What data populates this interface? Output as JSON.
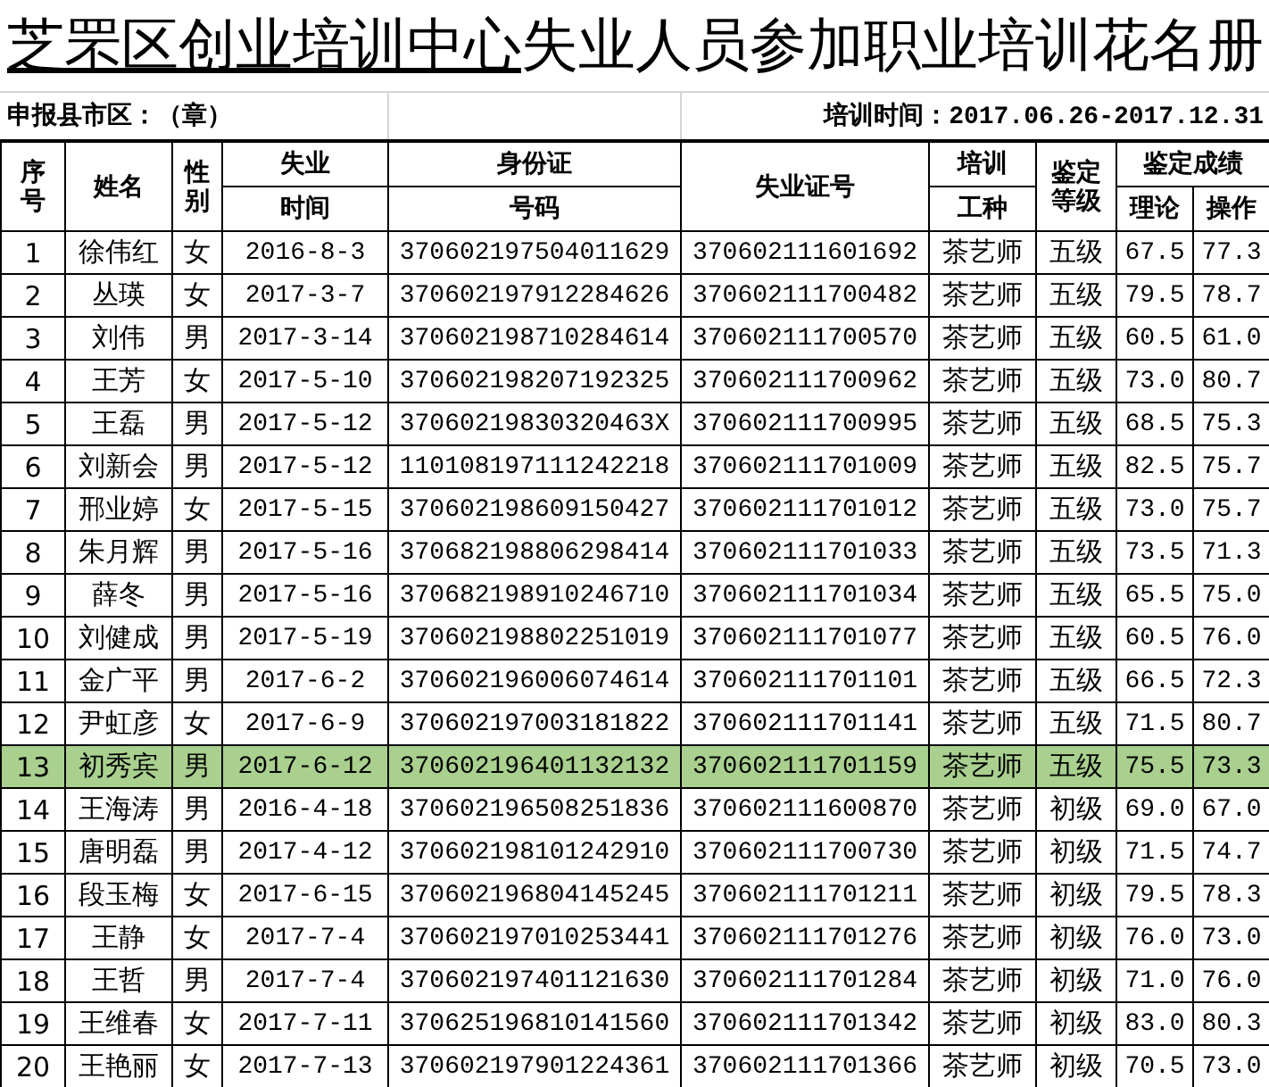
{
  "title": {
    "underlined": "芝罘区创业培训中心",
    "rest": "失业人员参加职业培训花名册"
  },
  "info": {
    "district": "申报县市区：（章）",
    "period": "培训时间：2017.06.26-2017.12.31"
  },
  "headers": {
    "seq": "序号",
    "name": "姓名",
    "gender": "性别",
    "time": [
      "失业",
      "时间"
    ],
    "id": [
      "身份证",
      "号码"
    ],
    "cert": "失业证号",
    "kind": [
      "培训",
      "工种"
    ],
    "level": "鉴定等级",
    "score": "鉴定成绩",
    "theory": "理论",
    "practice": "操作"
  },
  "rows": [
    {
      "no": "1",
      "name": "徐伟红",
      "gender": "女",
      "date": "2016-8-3",
      "id": "370602197504011629",
      "cert": "370602111601692",
      "job": "茶艺师",
      "grade": "五级",
      "theory": "67.5",
      "practice": "77.3",
      "selected": false
    },
    {
      "no": "2",
      "name": "丛瑛",
      "gender": "女",
      "date": "2017-3-7",
      "id": "370602197912284626",
      "cert": "370602111700482",
      "job": "茶艺师",
      "grade": "五级",
      "theory": "79.5",
      "practice": "78.7",
      "selected": false
    },
    {
      "no": "3",
      "name": "刘伟",
      "gender": "男",
      "date": "2017-3-14",
      "id": "370602198710284614",
      "cert": "370602111700570",
      "job": "茶艺师",
      "grade": "五级",
      "theory": "60.5",
      "practice": "61.0",
      "selected": false
    },
    {
      "no": "4",
      "name": "王芳",
      "gender": "女",
      "date": "2017-5-10",
      "id": "370602198207192325",
      "cert": "370602111700962",
      "job": "茶艺师",
      "grade": "五级",
      "theory": "73.0",
      "practice": "80.7",
      "selected": false
    },
    {
      "no": "5",
      "name": "王磊",
      "gender": "男",
      "date": "2017-5-12",
      "id": "37060219830320463X",
      "cert": "370602111700995",
      "job": "茶艺师",
      "grade": "五级",
      "theory": "68.5",
      "practice": "75.3",
      "selected": false
    },
    {
      "no": "6",
      "name": "刘新会",
      "gender": "男",
      "date": "2017-5-12",
      "id": "110108197111242218",
      "cert": "370602111701009",
      "job": "茶艺师",
      "grade": "五级",
      "theory": "82.5",
      "practice": "75.7",
      "selected": false
    },
    {
      "no": "7",
      "name": "邢业婷",
      "gender": "女",
      "date": "2017-5-15",
      "id": "370602198609150427",
      "cert": "370602111701012",
      "job": "茶艺师",
      "grade": "五级",
      "theory": "73.0",
      "practice": "75.7",
      "selected": false
    },
    {
      "no": "8",
      "name": "朱月辉",
      "gender": "男",
      "date": "2017-5-16",
      "id": "370682198806298414",
      "cert": "370602111701033",
      "job": "茶艺师",
      "grade": "五级",
      "theory": "73.5",
      "practice": "71.3",
      "selected": false
    },
    {
      "no": "9",
      "name": "薛冬",
      "gender": "男",
      "date": "2017-5-16",
      "id": "370682198910246710",
      "cert": "370602111701034",
      "job": "茶艺师",
      "grade": "五级",
      "theory": "65.5",
      "practice": "75.0",
      "selected": false
    },
    {
      "no": "10",
      "name": "刘健成",
      "gender": "男",
      "date": "2017-5-19",
      "id": "370602198802251019",
      "cert": "370602111701077",
      "job": "茶艺师",
      "grade": "五级",
      "theory": "60.5",
      "practice": "76.0",
      "selected": false
    },
    {
      "no": "11",
      "name": "金广平",
      "gender": "男",
      "date": "2017-6-2",
      "id": "370602196006074614",
      "cert": "370602111701101",
      "job": "茶艺师",
      "grade": "五级",
      "theory": "66.5",
      "practice": "72.3",
      "selected": false
    },
    {
      "no": "12",
      "name": "尹虹彦",
      "gender": "女",
      "date": "2017-6-9",
      "id": "370602197003181822",
      "cert": "370602111701141",
      "job": "茶艺师",
      "grade": "五级",
      "theory": "71.5",
      "practice": "80.7",
      "selected": false
    },
    {
      "no": "13",
      "name": "初秀宾",
      "gender": "男",
      "date": "2017-6-12",
      "id": "370602196401132132",
      "cert": "370602111701159",
      "job": "茶艺师",
      "grade": "五级",
      "theory": "75.5",
      "practice": "73.3",
      "selected": true
    },
    {
      "no": "14",
      "name": "王海涛",
      "gender": "男",
      "date": "2016-4-18",
      "id": "370602196508251836",
      "cert": "370602111600870",
      "job": "茶艺师",
      "grade": "初级",
      "theory": "69.0",
      "practice": "67.0",
      "selected": false
    },
    {
      "no": "15",
      "name": "唐明磊",
      "gender": "男",
      "date": "2017-4-12",
      "id": "370602198101242910",
      "cert": "370602111700730",
      "job": "茶艺师",
      "grade": "初级",
      "theory": "71.5",
      "practice": "74.7",
      "selected": false
    },
    {
      "no": "16",
      "name": "段玉梅",
      "gender": "女",
      "date": "2017-6-15",
      "id": "370602196804145245",
      "cert": "370602111701211",
      "job": "茶艺师",
      "grade": "初级",
      "theory": "79.5",
      "practice": "78.3",
      "selected": false
    },
    {
      "no": "17",
      "name": "王静",
      "gender": "女",
      "date": "2017-7-4",
      "id": "370602197010253441",
      "cert": "370602111701276",
      "job": "茶艺师",
      "grade": "初级",
      "theory": "76.0",
      "practice": "73.0",
      "selected": false
    },
    {
      "no": "18",
      "name": "王哲",
      "gender": "男",
      "date": "2017-7-4",
      "id": "370602197401121630",
      "cert": "370602111701284",
      "job": "茶艺师",
      "grade": "初级",
      "theory": "71.0",
      "practice": "76.0",
      "selected": false
    },
    {
      "no": "19",
      "name": "王维春",
      "gender": "女",
      "date": "2017-7-11",
      "id": "370625196810141560",
      "cert": "370602111701342",
      "job": "茶艺师",
      "grade": "初级",
      "theory": "83.0",
      "practice": "80.3",
      "selected": false
    },
    {
      "no": "20",
      "name": "王艳丽",
      "gender": "女",
      "date": "2017-7-13",
      "id": "370602197901224361",
      "cert": "370602111701366",
      "job": "茶艺师",
      "grade": "初级",
      "theory": "70.5",
      "practice": "73.0",
      "selected": false
    }
  ]
}
